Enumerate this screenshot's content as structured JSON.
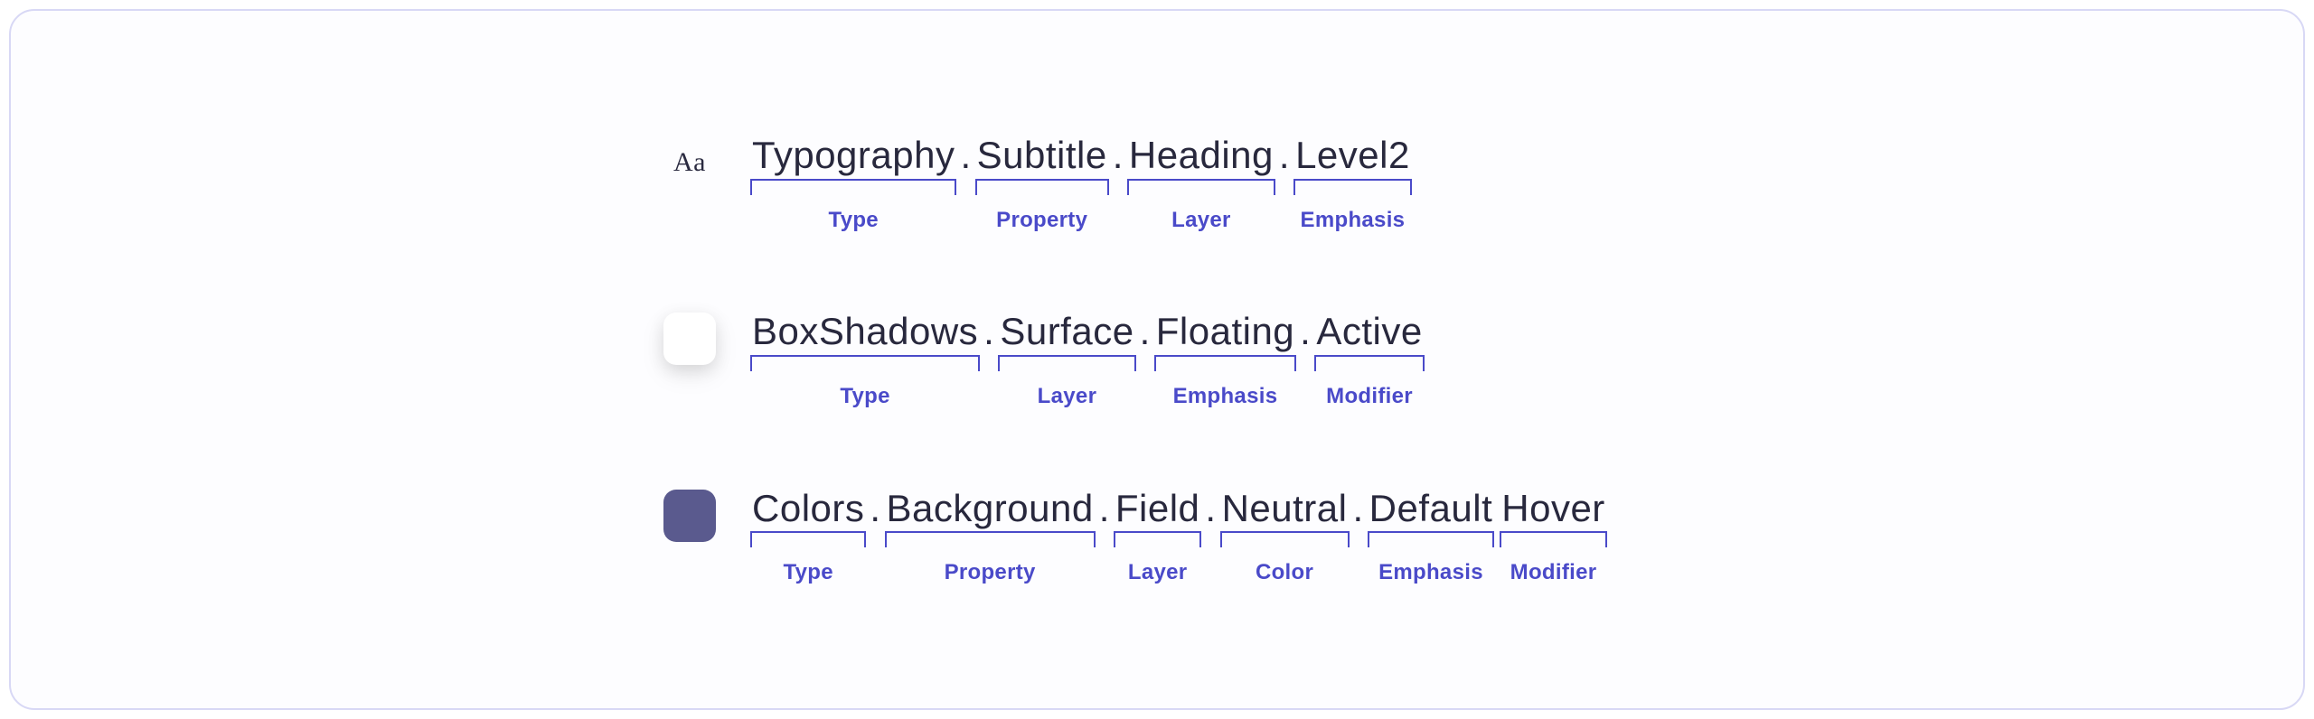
{
  "rows": [
    {
      "icon": {
        "kind": "text",
        "value": "Aa"
      },
      "segments": [
        {
          "word": "Typography",
          "label": "Type"
        },
        {
          "word": "Subtitle",
          "label": "Property"
        },
        {
          "word": "Heading",
          "label": "Layer"
        },
        {
          "word": "Level2",
          "label": "Emphasis"
        }
      ]
    },
    {
      "icon": {
        "kind": "box",
        "class": "swatch-white"
      },
      "segments": [
        {
          "word": "BoxShadows",
          "label": "Type"
        },
        {
          "word": "Surface",
          "label": "Layer"
        },
        {
          "word": "Floating",
          "label": "Emphasis"
        },
        {
          "word": "Active",
          "label": "Modifier"
        }
      ]
    },
    {
      "icon": {
        "kind": "box",
        "class": "swatch-purple"
      },
      "segments": [
        {
          "word": "Colors",
          "label": "Type"
        },
        {
          "word": "Background",
          "label": "Property"
        },
        {
          "word": "Field",
          "label": "Layer"
        },
        {
          "word": "Neutral",
          "label": "Color"
        },
        {
          "word": "Default",
          "label": "Emphasis"
        },
        {
          "word": "Hover",
          "label": "Modifier"
        }
      ]
    }
  ],
  "colors": {
    "accent": "#4a4ac9",
    "text": "#28283d",
    "border": "#d8d8f5",
    "swatch_purple": "#5a5a8e"
  }
}
